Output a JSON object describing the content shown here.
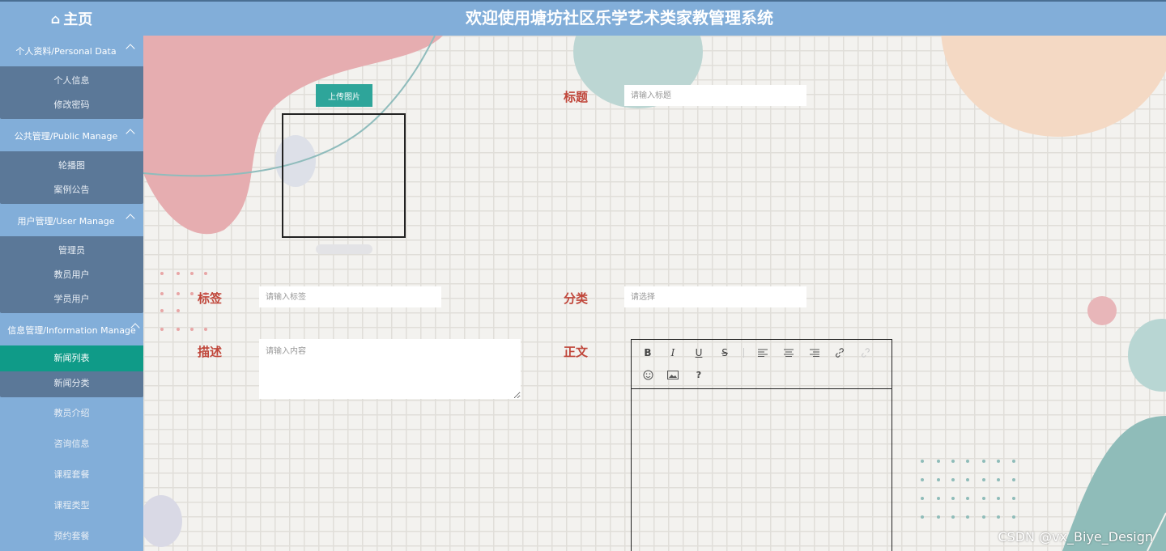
{
  "header": {
    "home_label": "主页",
    "title": "欢迎使用塘坊社区乐学艺术类家教管理系统"
  },
  "sidebar": {
    "groups": [
      {
        "label": "个人资料/Personal Data",
        "items": [
          "个人信息",
          "修改密码"
        ]
      },
      {
        "label": "公共管理/Public Manage",
        "items": [
          "轮播图",
          "案例公告"
        ]
      },
      {
        "label": "用户管理/User Manage",
        "items": [
          "管理员",
          "教员用户",
          "学员用户"
        ]
      },
      {
        "label": "信息管理/Information Manage",
        "items": [
          "新闻列表",
          "新闻分类"
        ]
      }
    ],
    "active_item": "新闻列表",
    "plain_items": [
      "教员介绍",
      "咨询信息",
      "课程套餐",
      "课程类型",
      "预约套餐"
    ]
  },
  "form": {
    "upload_label": "上传图片",
    "title_label": "标题",
    "title_placeholder": "请输入标题",
    "tag_label": "标签",
    "tag_placeholder": "请输入标签",
    "category_label": "分类",
    "category_placeholder": "请选择",
    "desc_label": "描述",
    "desc_placeholder": "请输入内容",
    "body_label": "正文"
  },
  "editor_toolbar": [
    "bold-icon",
    "italic-icon",
    "underline-icon",
    "strikethrough-icon",
    "align-left-icon",
    "align-center-icon",
    "align-right-icon",
    "link-icon",
    "unlink-icon",
    "emoji-icon",
    "image-icon",
    "help-icon"
  ],
  "colors": {
    "sidebar": "#82aed9",
    "submenu": "#5b7898",
    "active": "#0f9b88",
    "label": "#c0463a",
    "upload": "#2ea59a"
  },
  "watermark": "CSDN @vx_Biye_Design"
}
